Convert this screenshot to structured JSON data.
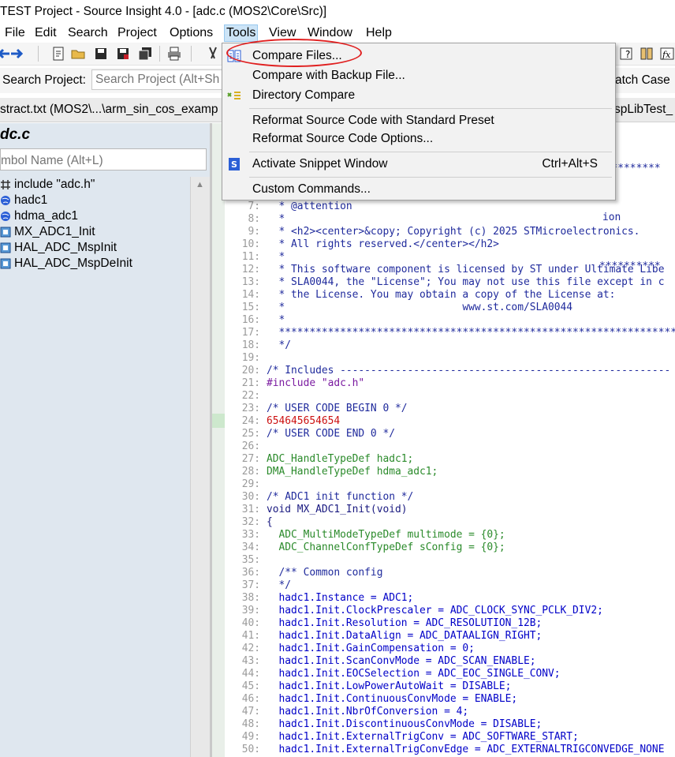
{
  "window": {
    "title": "TEST Project - Source Insight 4.0 - [adc.c (MOS2\\Core\\Src)]"
  },
  "menubar": {
    "items": [
      "File",
      "Edit",
      "Search",
      "Project",
      "Options",
      "Tools",
      "View",
      "Window",
      "Help"
    ]
  },
  "search": {
    "label": "Search Project:",
    "placeholder": "Search Project (Alt+Sh",
    "match_case": "atch Case"
  },
  "tabs": [
    "stract.txt (MOS2\\...\\arm_sin_cos_examp",
    "spLibTest_"
  ],
  "symbol_panel": {
    "title": "dc.c",
    "search_placeholder": "mbol Name (Alt+L)",
    "items": [
      "include \"adc.h\"",
      "hadc1",
      "hdma_adc1",
      "MX_ADC1_Init",
      "HAL_ADC_MspInit",
      "HAL_ADC_MspDeInit"
    ]
  },
  "tools_menu": {
    "items": [
      {
        "label": "Compare Files...",
        "icon": "compare-files-icon",
        "shortcut": ""
      },
      {
        "label": "Compare with Backup File...",
        "icon": "",
        "shortcut": ""
      },
      {
        "label": "Directory Compare",
        "icon": "directory-compare-icon",
        "shortcut": ""
      },
      {
        "label": "Reformat Source Code with Standard Preset",
        "icon": "",
        "shortcut": ""
      },
      {
        "label": "Reformat Source Code Options...",
        "icon": "",
        "shortcut": ""
      },
      {
        "label": "Activate Snippet Window",
        "icon": "snippet-icon",
        "shortcut": "Ctrl+Alt+S"
      },
      {
        "label": "Custom Commands...",
        "icon": "",
        "shortcut": ""
      }
    ]
  },
  "editor": {
    "hidden_top": [
      "**********",
      "ion",
      "**********"
    ],
    "lines": [
      {
        "n": "7:",
        "t": "  * @attention"
      },
      {
        "n": "8:",
        "t": "  *"
      },
      {
        "n": "9:",
        "t": "  * <h2><center>&copy; Copyright (c) 2025 STMicroelectronics."
      },
      {
        "n": "10:",
        "t": "  * All rights reserved.</center></h2>"
      },
      {
        "n": "11:",
        "t": "  *"
      },
      {
        "n": "12:",
        "t": "  * This software component is licensed by ST under Ultimate Libe"
      },
      {
        "n": "13:",
        "t": "  * SLA0044, the \"License\"; You may not use this file except in c"
      },
      {
        "n": "14:",
        "t": "  * the License. You may obtain a copy of the License at:"
      },
      {
        "n": "15:",
        "t": "  *                             www.st.com/SLA0044"
      },
      {
        "n": "16:",
        "t": "  *"
      },
      {
        "n": "17:",
        "t": "  ******************************************************************"
      },
      {
        "n": "18:",
        "t": "  */"
      },
      {
        "n": "19:",
        "t": ""
      },
      {
        "n": "20:",
        "t": "/* Includes ------------------------------------------------------"
      },
      {
        "n": "21:",
        "t": "#include \"adc.h\""
      },
      {
        "n": "22:",
        "t": ""
      },
      {
        "n": "23:",
        "t": "/* USER CODE BEGIN 0 */"
      },
      {
        "n": "24:",
        "t": "654645654654"
      },
      {
        "n": "25:",
        "t": "/* USER CODE END 0 */"
      },
      {
        "n": "26:",
        "t": ""
      },
      {
        "n": "27:",
        "t": "ADC_HandleTypeDef hadc1;"
      },
      {
        "n": "28:",
        "t": "DMA_HandleTypeDef hdma_adc1;"
      },
      {
        "n": "29:",
        "t": ""
      },
      {
        "n": "30:",
        "t": "/* ADC1 init function */"
      },
      {
        "n": "31:",
        "t": "void MX_ADC1_Init(void)"
      },
      {
        "n": "32:",
        "t": "{"
      },
      {
        "n": "33:",
        "t": "  ADC_MultiModeTypeDef multimode = {0};"
      },
      {
        "n": "34:",
        "t": "  ADC_ChannelConfTypeDef sConfig = {0};"
      },
      {
        "n": "35:",
        "t": ""
      },
      {
        "n": "36:",
        "t": "  /** Common config"
      },
      {
        "n": "37:",
        "t": "  */"
      },
      {
        "n": "38:",
        "t": "  hadc1.Instance = ADC1;"
      },
      {
        "n": "39:",
        "t": "  hadc1.Init.ClockPrescaler = ADC_CLOCK_SYNC_PCLK_DIV2;"
      },
      {
        "n": "40:",
        "t": "  hadc1.Init.Resolution = ADC_RESOLUTION_12B;"
      },
      {
        "n": "41:",
        "t": "  hadc1.Init.DataAlign = ADC_DATAALIGN_RIGHT;"
      },
      {
        "n": "42:",
        "t": "  hadc1.Init.GainCompensation = 0;"
      },
      {
        "n": "43:",
        "t": "  hadc1.Init.ScanConvMode = ADC_SCAN_ENABLE;"
      },
      {
        "n": "44:",
        "t": "  hadc1.Init.EOCSelection = ADC_EOC_SINGLE_CONV;"
      },
      {
        "n": "45:",
        "t": "  hadc1.Init.LowPowerAutoWait = DISABLE;"
      },
      {
        "n": "46:",
        "t": "  hadc1.Init.ContinuousConvMode = ENABLE;"
      },
      {
        "n": "47:",
        "t": "  hadc1.Init.NbrOfConversion = 4;"
      },
      {
        "n": "48:",
        "t": "  hadc1.Init.DiscontinuousConvMode = DISABLE;"
      },
      {
        "n": "49:",
        "t": "  hadc1.Init.ExternalTrigConv = ADC_SOFTWARE_START;"
      },
      {
        "n": "50:",
        "t": "  hadc1.Init.ExternalTrigConvEdge = ADC_EXTERNALTRIGCONVEDGE_NONE"
      }
    ]
  },
  "colors": {
    "menu_highlight": "#cce4f7",
    "annotation_ellipse": "#e02020",
    "panel_bg": "#dfe7ef"
  }
}
